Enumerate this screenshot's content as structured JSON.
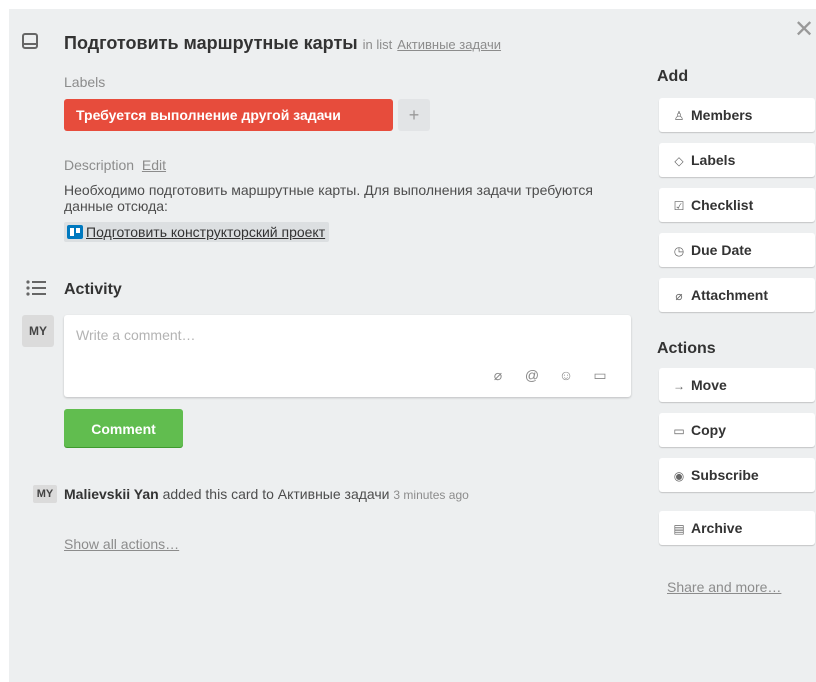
{
  "card": {
    "title": "Подготовить маршрутные карты",
    "in_list_prefix": "in list",
    "list_name": "Активные задачи",
    "close_glyph": "✕"
  },
  "labels": {
    "heading": "Labels",
    "items": [
      {
        "text": "Требуется выполнение другой задачи",
        "color": "#e74c3c"
      }
    ],
    "add_glyph": "+"
  },
  "description": {
    "heading": "Description",
    "edit_label": "Edit",
    "text": "Необходимо подготовить маршрутные карты. Для выполнения задачи требуются данные отсюда:",
    "link_text": "Подготовить конструкторский проект"
  },
  "activity": {
    "heading": "Activity",
    "avatar_initials": "MY",
    "comment_placeholder": "Write a comment…",
    "tools": [
      "attachment-icon",
      "mention-icon",
      "emoji-icon",
      "card-icon"
    ],
    "tool_glyphs": [
      "⌀",
      "@",
      "☺",
      "▭"
    ],
    "comment_button": "Comment",
    "entries": [
      {
        "initials": "MY",
        "user": "Malievskii Yan",
        "action": "added this card to Активные задачи",
        "time": "3 minutes ago"
      }
    ],
    "show_all": "Show all actions…"
  },
  "sidebar": {
    "add_heading": "Add",
    "add_buttons": [
      {
        "label": "Members",
        "icon": "person-icon",
        "glyph": "♙"
      },
      {
        "label": "Labels",
        "icon": "tag-icon",
        "glyph": "◇"
      },
      {
        "label": "Checklist",
        "icon": "checkbox-icon",
        "glyph": "☑"
      },
      {
        "label": "Due Date",
        "icon": "clock-icon",
        "glyph": "◷"
      },
      {
        "label": "Attachment",
        "icon": "paperclip-icon",
        "glyph": "⌀"
      }
    ],
    "actions_heading": "Actions",
    "action_buttons": [
      {
        "label": "Move",
        "icon": "arrow-right-icon",
        "glyph": "→"
      },
      {
        "label": "Copy",
        "icon": "copy-icon",
        "glyph": "▭"
      },
      {
        "label": "Subscribe",
        "icon": "eye-icon",
        "glyph": "◉"
      },
      {
        "label": "Archive",
        "icon": "archive-icon",
        "glyph": "▤"
      }
    ],
    "share_link": "Share and more…"
  },
  "colors": {
    "accent_green": "#61bd4f",
    "label_red": "#e74c3c",
    "panel_bg": "#edeff0"
  }
}
